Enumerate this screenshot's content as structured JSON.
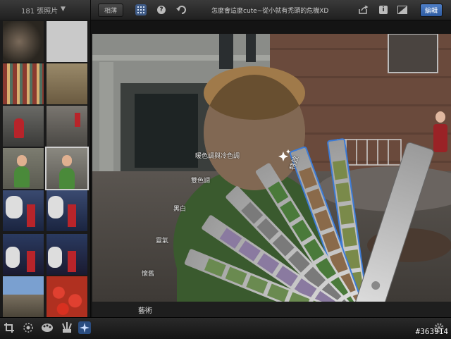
{
  "topbar": {
    "photo_count": "181 張照片",
    "album_button": "相薄",
    "title": "怎麼會這麼cute~從小就有禿頭的危機XD",
    "edit_button": "編輯",
    "help_glyph": "?",
    "info_glyph": "i"
  },
  "effects": {
    "panel_label": "特效",
    "items": [
      "暖色調與冷色調",
      "雙色調",
      "黑白",
      "靈氣",
      "懷舊",
      "藝術"
    ]
  },
  "watermark": "#363914",
  "colors": {
    "accent": "#3c7bd6",
    "topbar": "#2c2c2c",
    "background": "#141414"
  },
  "icons": [
    "grid-icon",
    "help-icon",
    "undo-icon",
    "share-icon",
    "info-icon",
    "compare-icon",
    "crop-icon",
    "exposure-icon",
    "color-icon",
    "brushes-icon",
    "effects-icon",
    "settings-icon"
  ]
}
